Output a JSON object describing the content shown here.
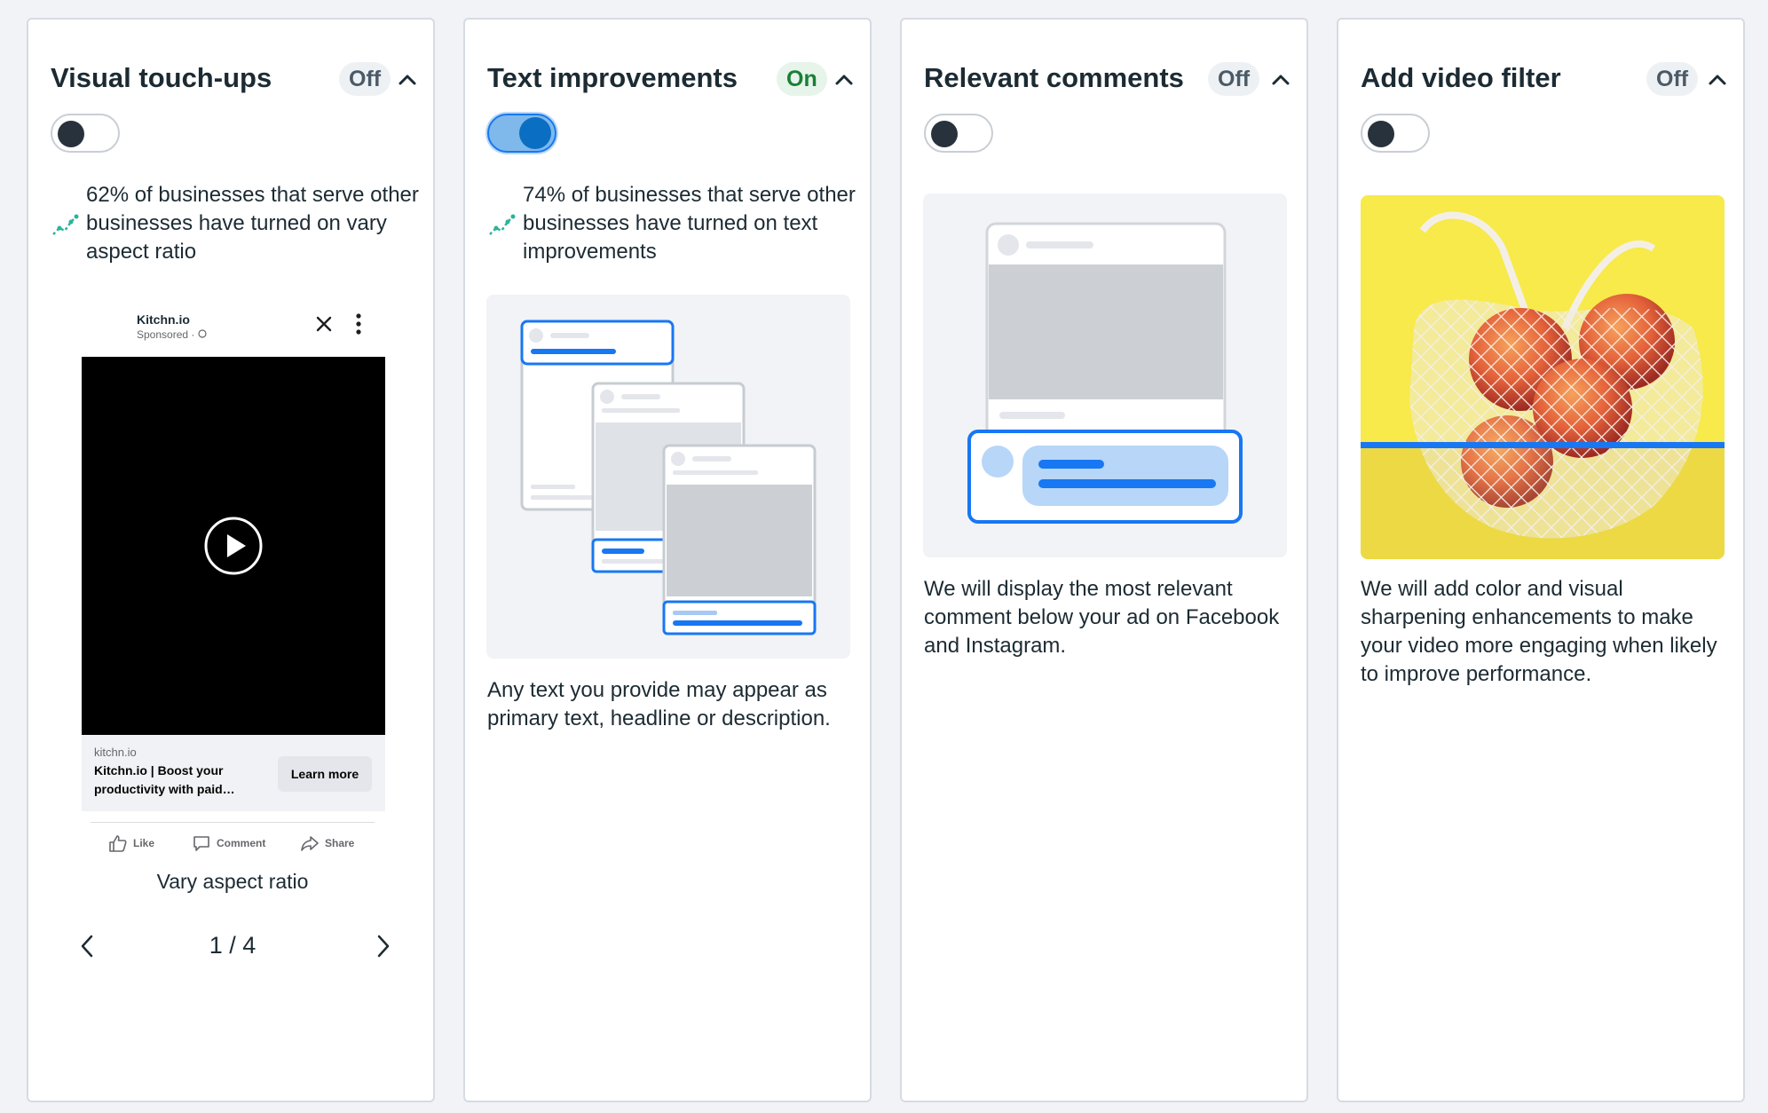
{
  "cards": [
    {
      "title": "Visual touch-ups",
      "status": "Off",
      "stat": "62% of businesses that serve other businesses have turned on vary aspect ratio",
      "ad_preview": {
        "brand": "Kitchn.io",
        "sponsored": "Sponsored · ",
        "domain": "kitchn.io",
        "headline": "Kitchn.io | Boost your productivity with paid…",
        "cta": "Learn more",
        "actions": [
          "Like",
          "Comment",
          "Share"
        ]
      },
      "caption": "Vary aspect ratio",
      "pager": "1 / 4"
    },
    {
      "title": "Text improvements",
      "status": "On",
      "stat": "74% of businesses that serve other businesses have turned on text improvements",
      "description": "Any text you provide may appear as primary text, headline or description."
    },
    {
      "title": "Relevant comments",
      "status": "Off",
      "description": "We will display the most relevant comment below your ad on Facebook and Instagram."
    },
    {
      "title": "Add video filter",
      "status": "Off",
      "description": "We will add color and visual sharpening enhancements to make your video more engaging when likely to improve performance."
    }
  ],
  "colors": {
    "accent": "#1877f2",
    "on_badge": "#1a7f37",
    "stat_icon": "#2bb39a",
    "photo_bg": "#f6e94a"
  },
  "icons": [
    "trend-icon",
    "chevron-up-icon",
    "close-icon",
    "more-icon",
    "play-icon",
    "like-icon",
    "comment-icon",
    "share-icon",
    "chevron-left-icon",
    "chevron-right-icon"
  ]
}
